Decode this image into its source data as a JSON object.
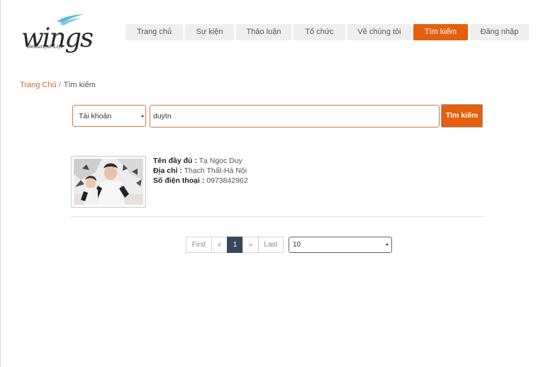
{
  "logo": {
    "word": "wings",
    "tagline": "Beautiful Life"
  },
  "nav": {
    "items": [
      {
        "label": "Trang chủ"
      },
      {
        "label": "Sự kiện"
      },
      {
        "label": "Thảo luận"
      },
      {
        "label": "Tổ chức"
      },
      {
        "label": "Về chúng tôi"
      },
      {
        "label": "Tìm kiếm",
        "active": true
      },
      {
        "label": "Đăng nhập"
      }
    ]
  },
  "breadcrumb": {
    "home": "Trang Chủ",
    "separator": "/",
    "current": "Tìm kiếm"
  },
  "search": {
    "type_selected": "Tài khoản",
    "query": "duytn",
    "button_label": "Tìm kiếm"
  },
  "results": [
    {
      "photo_icon": "couple-photo",
      "name_label": "Tên đầy đủ :",
      "name": "Tạ Ngọc Duy",
      "address_label": "Địa chỉ :",
      "address": "Thạch Thất-Hà Nội",
      "phone_label": "Số điện thoại :",
      "phone": "0973842962"
    }
  ],
  "pagination": {
    "first": "First",
    "prev": "«",
    "current": "1",
    "next": "»",
    "last": "Last",
    "page_size": "10"
  },
  "colors": {
    "accent": "#e4600e",
    "pager_active": "#36485d",
    "link": "#d0692a"
  }
}
